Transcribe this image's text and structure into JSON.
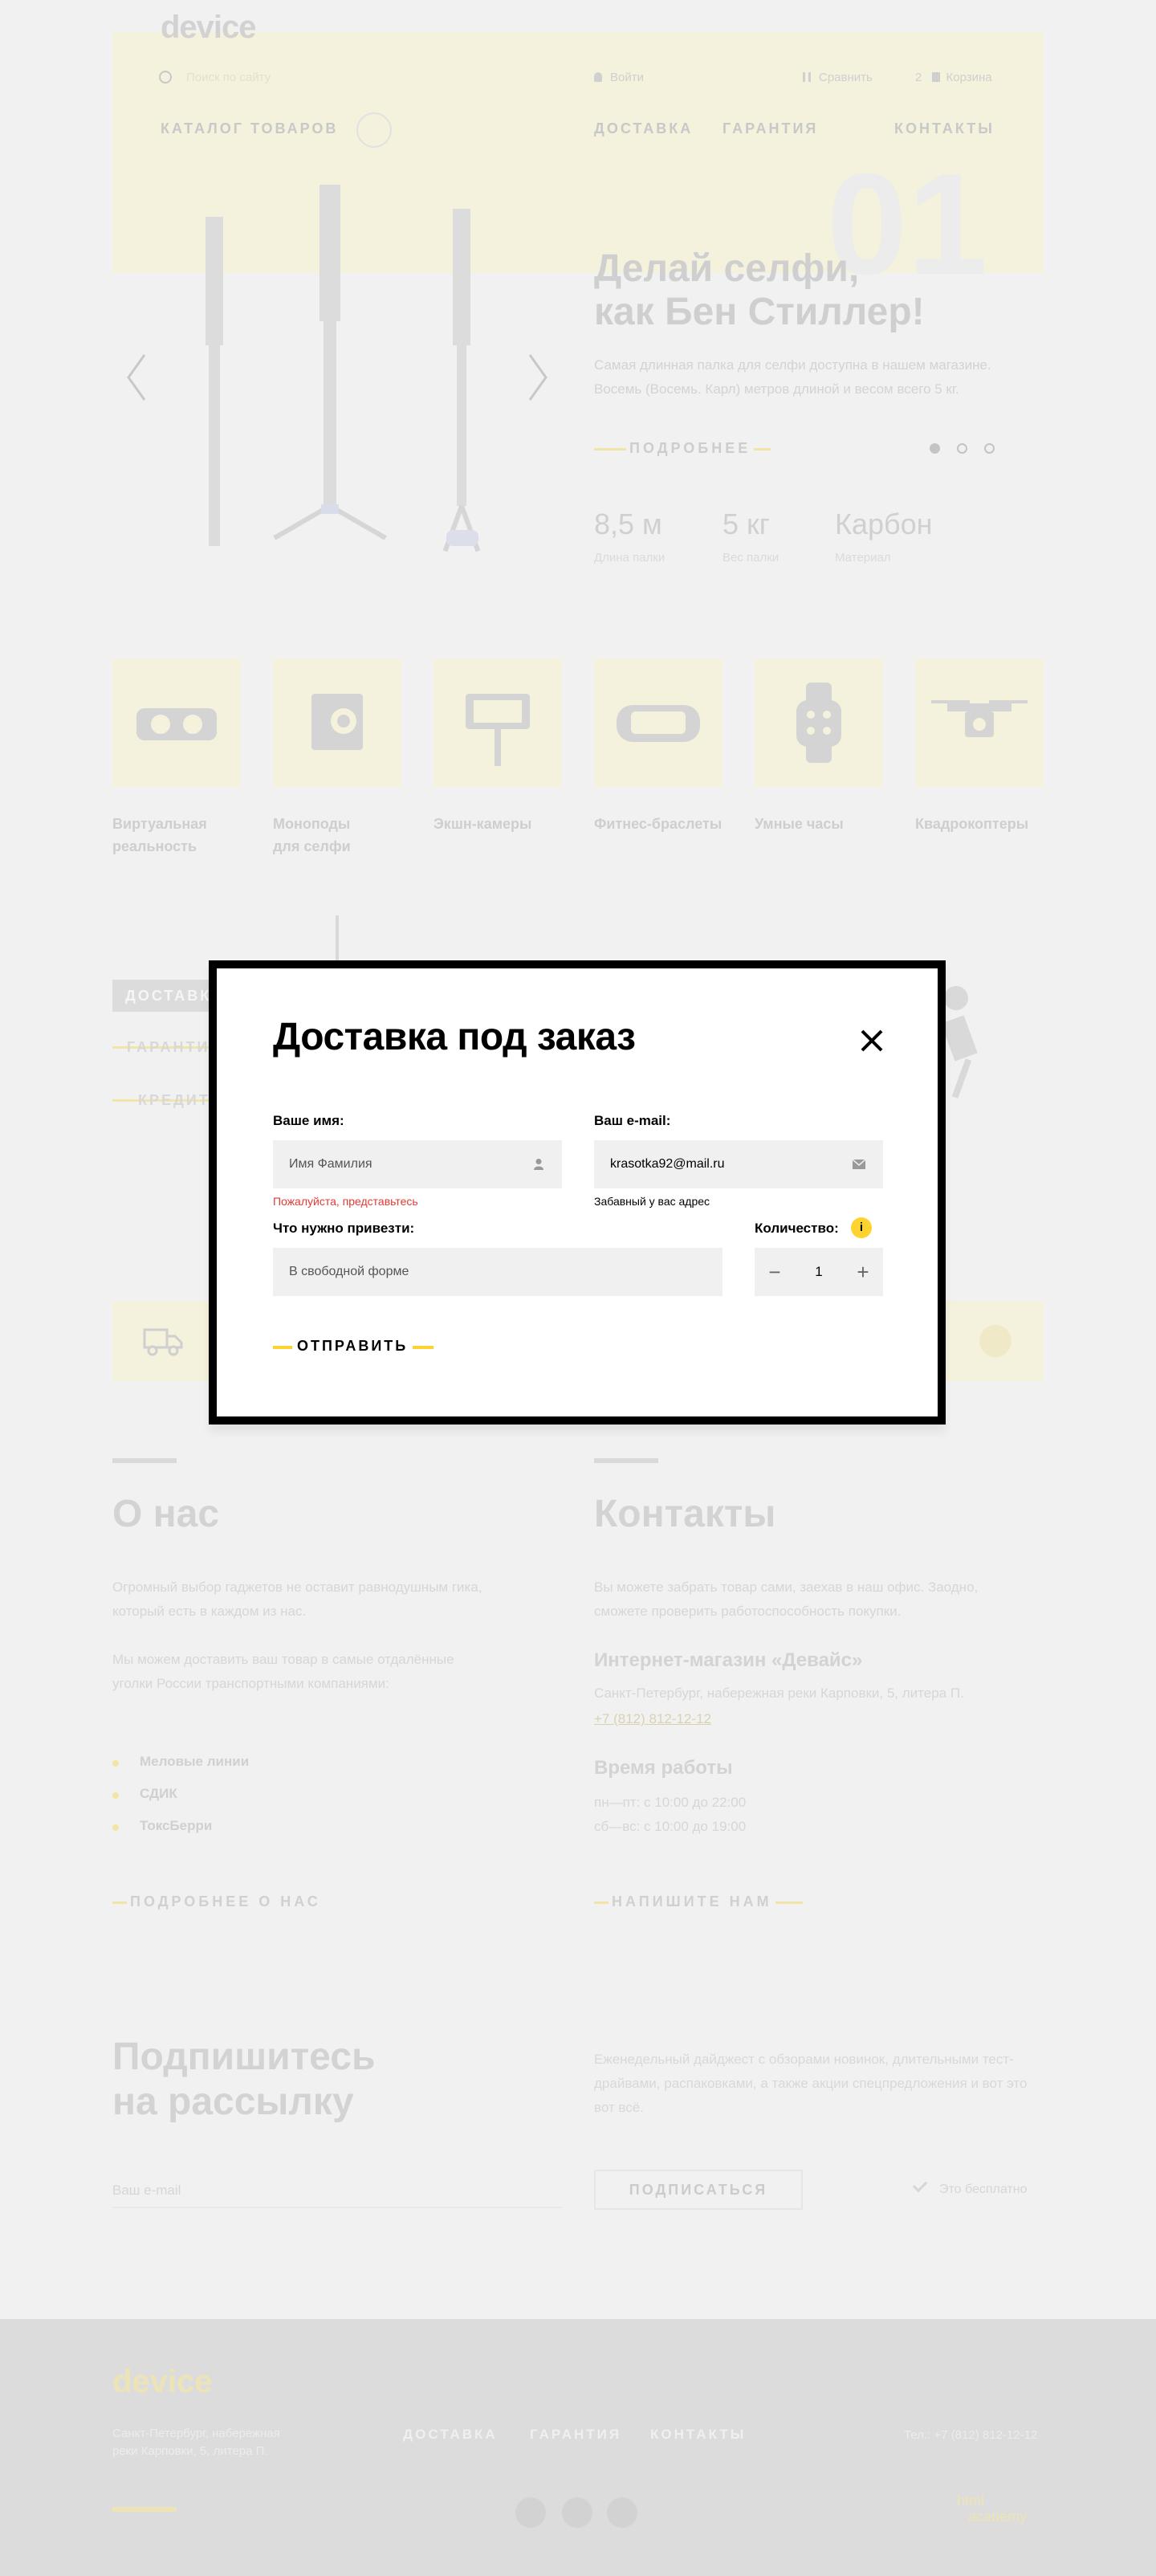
{
  "header": {
    "logo": "device",
    "search_placeholder": "Поиск по сайту",
    "login": "Войти",
    "compare": "Сравнить",
    "cart_count": "2",
    "cart": "Корзина",
    "catalog": "КАТАЛОГ ТОВАРОВ",
    "nav": [
      "ДОСТАВКА",
      "ГАРАНТИЯ",
      "КОНТАКТЫ"
    ]
  },
  "hero": {
    "slide_number": "01",
    "title_line1": "Делай селфи,",
    "title_line2": "как Бен Стиллер!",
    "text": "Самая длинная палка для селфи доступна в нашем магазине. Восемь (Восемь. Карл) метров длиной и весом всего 5 кг.",
    "more": "ПОДРОБНЕЕ",
    "specs": [
      {
        "value": "8,5 м",
        "label": "Длина палки"
      },
      {
        "value": "5 кг",
        "label": "Вес палки"
      },
      {
        "value": "Карбон",
        "label": "Материал"
      }
    ]
  },
  "categories": [
    {
      "label1": "Виртуальная",
      "label2": "реальность",
      "icon": "vr-headset-icon"
    },
    {
      "label1": "Моноподы",
      "label2": "для селфи",
      "icon": "action-camera-icon"
    },
    {
      "label1": "Экшн-камеры",
      "label2": "",
      "icon": "phone-monopod-icon"
    },
    {
      "label1": "Фитнес-браслеты",
      "label2": "",
      "icon": "fitness-band-icon"
    },
    {
      "label1": "Умные часы",
      "label2": "",
      "icon": "smart-watch-icon"
    },
    {
      "label1": "Квадрокоптеры",
      "label2": "",
      "icon": "drone-icon"
    }
  ],
  "services": {
    "tab": "ДОСТАВКА",
    "links": [
      "ГАРАНТИЯ",
      "КРЕДИТ"
    ]
  },
  "about": {
    "title": "О нас",
    "p1": "Огромный выбор гаджетов не оставит равнодушным гика, который есть в каждом из нас.",
    "p2": "Мы можем доставить ваш товар в самые отдалённые уголки России транспортными компаниями:",
    "companies": [
      "Меловые линии",
      "СДИК",
      "ТоксБерри"
    ],
    "more": "ПОДРОБНЕЕ О НАС"
  },
  "contacts": {
    "title": "Контакты",
    "text": "Вы можете забрать товар сами, заехав в наш офис. Заодно, сможете проверить работоспособность покупки.",
    "shop_title": "Интернет-магазин «Девайс»",
    "address": "Санкт-Петербург, набережная реки Карповки, 5, литера П.",
    "phone": "+7 (812) 812-12-12",
    "hours_title": "Время работы",
    "hours1": "пн—пт: с 10:00 до 22:00",
    "hours2": "сб—вс: с 10:00 до 19:00",
    "write": "НАПИШИТЕ НАМ"
  },
  "subscribe": {
    "title_line1": "Подпишитесь",
    "title_line2": "на рассылку",
    "text": "Еженедельный дайджест с обзорами новинок, длительными тест-драйвами, распаковками, а также акции спецпредложения и вот это вот всё.",
    "email_placeholder": "Ваш e-mail",
    "button": "ПОДПИСАТЬСЯ",
    "free": "Это бесплатно"
  },
  "footer": {
    "logo": "device",
    "address_line1": "Санкт-Петербург, набережная",
    "address_line2": "реки Карповки, 5, литера П.",
    "nav": [
      "ДОСТАВКА",
      "ГАРАНТИЯ",
      "КОНТАКТЫ"
    ],
    "tel": "Тел.: +7 (812) 812-12-12",
    "academy_line1": "html",
    "academy_line2": "academy"
  },
  "modal": {
    "title": "Доставка под заказ",
    "name_label": "Ваше имя:",
    "name_placeholder": "Имя Фамилия",
    "name_error": "Пожалуйста, представьтесь",
    "email_label": "Ваш e-mail:",
    "email_value": "krasotka92@mail.ru",
    "email_hint": "Забавный у вас адрес",
    "what_label": "Что нужно привезти:",
    "what_placeholder": "В свободной форме",
    "qty_label": "Количество:",
    "qty_value": "1",
    "info": "i",
    "submit": "ОТПРАВИТЬ"
  },
  "colors": {
    "accent": "#fed330",
    "error": "#e53935",
    "overlay_bg": "#f1f1f1"
  }
}
